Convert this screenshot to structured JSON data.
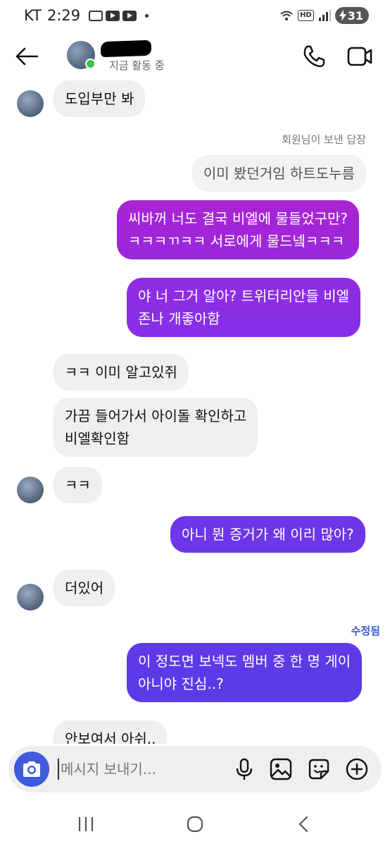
{
  "status_bar": {
    "carrier": "KT",
    "time": "2:29",
    "hd": "HD",
    "battery": "31"
  },
  "header": {
    "active_status": "지금 활동 중"
  },
  "messages": [
    {
      "side": "in",
      "text": "도입부만 봐"
    },
    {
      "side": "reply-label",
      "text": "회원님이 보낸 답장"
    },
    {
      "side": "reply-quote",
      "text": "이미 봤던거임 하트도누름"
    },
    {
      "side": "out",
      "lines": [
        "씨바꺼 너도 결국 비엘에 물들었구만?",
        "ㅋㅋㅋㄲㅋㅋ 서로에게 물드넼ㅋㅋㅋ"
      ]
    },
    {
      "side": "out",
      "lines": [
        "야 너 그거 알아? 트위터리안들 비엘",
        "존나 개좋아함"
      ]
    },
    {
      "side": "in",
      "text": "ㅋㅋ 이미 알고있쥐"
    },
    {
      "side": "in",
      "lines": [
        "가끔 들어가서 아이돌 확인하고",
        "비엘확인함"
      ]
    },
    {
      "side": "in",
      "text": "ㅋㅋ"
    },
    {
      "side": "out",
      "text": "아니 뭔 증거가 왜 이리 많아?"
    },
    {
      "side": "in",
      "text": "더있어"
    },
    {
      "side": "edited",
      "text": "수정됨"
    },
    {
      "side": "out",
      "lines": [
        "이 정도면 보넥도 멤버 중 한 명 게이",
        "아니야 진심..?"
      ]
    },
    {
      "side": "in",
      "text": "안보여서 아쉬.."
    }
  ],
  "composer": {
    "placeholder": "메시지 보내기..."
  },
  "colors": {
    "out_top": "#a324d4",
    "out_mid": "#8a2ee6",
    "out_bottom": "#5c3ae6",
    "camera": "#3f5bdc",
    "edited": "#3b5bd6"
  },
  "icons": [
    "back-arrow-icon",
    "phone-icon",
    "video-icon",
    "camera-icon",
    "microphone-icon",
    "gallery-icon",
    "sticker-icon",
    "plus-icon",
    "recents-icon",
    "home-icon",
    "back-icon"
  ]
}
